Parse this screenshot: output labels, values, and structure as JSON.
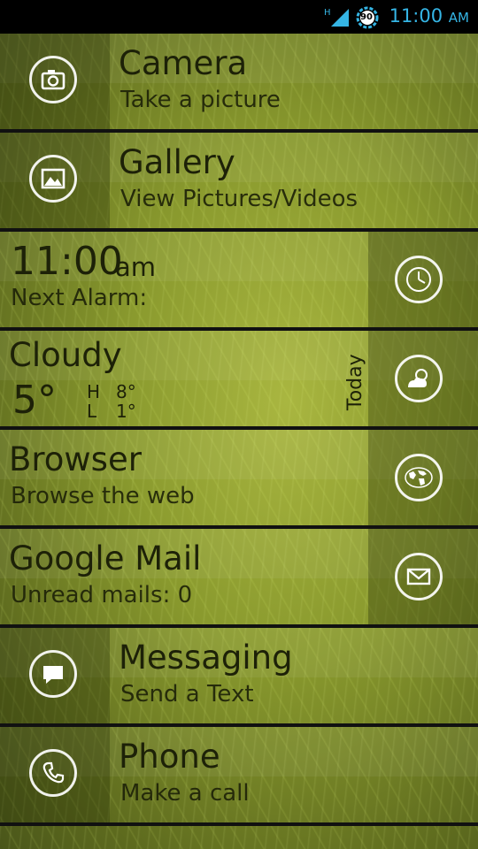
{
  "status_bar": {
    "network_label": "H",
    "battery_level": "90",
    "time": "11:00",
    "ampm": "AM",
    "time_color": "#35b5e5"
  },
  "tiles": {
    "camera": {
      "title": "Camera",
      "subtitle": "Take a picture",
      "icon": "camera-icon"
    },
    "gallery": {
      "title": "Gallery",
      "subtitle": "View Pictures/Videos",
      "icon": "picture-icon"
    },
    "clock": {
      "time": "11:00",
      "ampm": "am",
      "subtitle": "Next Alarm:",
      "icon": "clock-icon"
    },
    "weather": {
      "condition": "Cloudy",
      "temp": "5°",
      "high_label": "H",
      "high_value": "8°",
      "low_label": "L",
      "low_value": "1°",
      "day": "Today",
      "icon": "weather-cloud-sun-icon"
    },
    "browser": {
      "title": "Browser",
      "subtitle": "Browse the web",
      "icon": "globe-icon"
    },
    "mail": {
      "title": "Google Mail",
      "subtitle": "Unread mails: 0",
      "icon": "envelope-icon"
    },
    "messaging": {
      "title": "Messaging",
      "subtitle": "Send a Text",
      "icon": "chat-bubble-icon"
    },
    "phone": {
      "title": "Phone",
      "subtitle": "Make a call",
      "icon": "phone-icon"
    }
  },
  "theme": {
    "tile_text_color": "#1d2108",
    "icon_color": "#ffffff",
    "divider_color": "#111111"
  }
}
